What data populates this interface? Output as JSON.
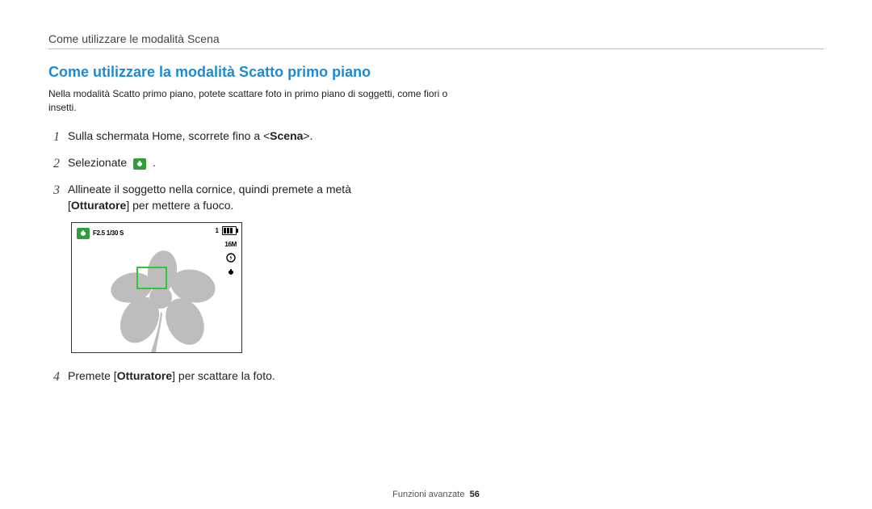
{
  "header": {
    "breadcrumb": "Come utilizzare le modalità Scena"
  },
  "section": {
    "title": "Come utilizzare la modalità Scatto primo piano",
    "intro": "Nella modalità Scatto primo piano, potete scattare foto in primo piano di soggetti, come fiori o insetti."
  },
  "steps": {
    "s1_pre": "Sulla schermata Home, scorrete fino a <",
    "s1_bold": "Scena",
    "s1_post": ">.",
    "s2_pre": "Selezionate ",
    "s2_post": " .",
    "s3_line1": "Allineate il soggetto nella cornice, quindi premete a metà",
    "s3_line2_pre": "[",
    "s3_line2_bold": "Otturatore",
    "s3_line2_post": "] per mettere a fuoco.",
    "s4_pre": "Premete [",
    "s4_bold": "Otturatore",
    "s4_post": "] per scattare la foto."
  },
  "numbers": {
    "n1": "1",
    "n2": "2",
    "n3": "3",
    "n4": "4"
  },
  "camera": {
    "exposure": "F2.5 1/30 S",
    "count": "1",
    "resolution": "16M"
  },
  "footer": {
    "label": "Funzioni avanzate",
    "page": "56"
  }
}
